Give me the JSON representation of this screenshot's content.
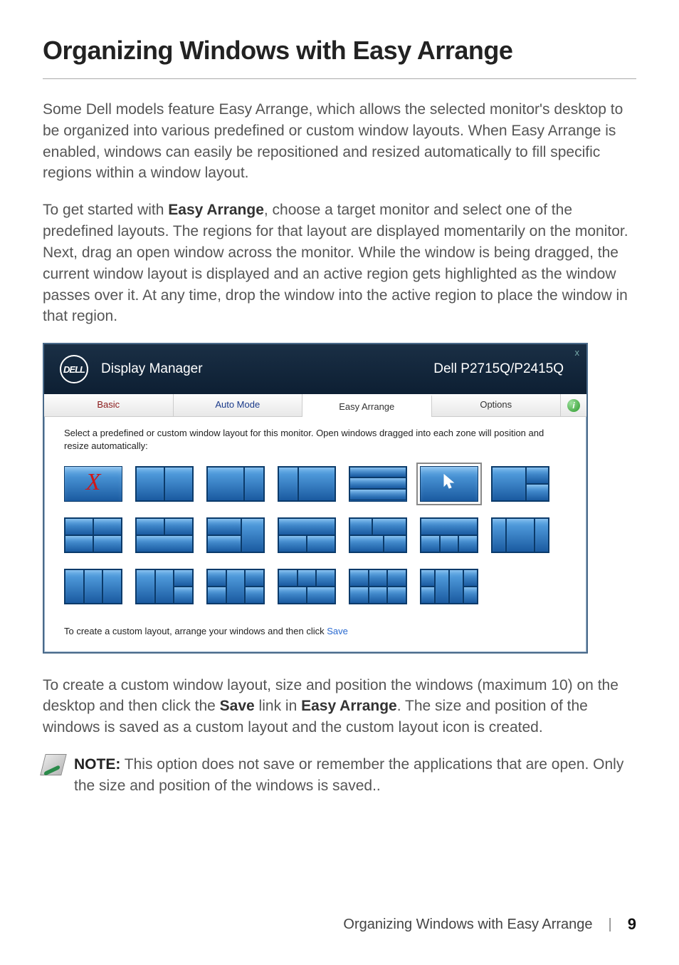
{
  "heading": "Organizing Windows with Easy Arrange",
  "para1": "Some Dell models feature Easy Arrange, which allows the selected monitor's desktop to be organized into various predefined or custom window layouts. When Easy Arrange is enabled, windows can easily be repositioned and resized automatically to fill specific regions within a window layout.",
  "para2_pre": "To get started with ",
  "para2_bold": "Easy Arrange",
  "para2_post": ", choose a target monitor and select one of the predefined layouts. The regions for that layout are displayed momentarily on the monitor. Next, drag an open window across the monitor. While the window is being dragged, the current window layout is displayed and an active region gets highlighted as the window passes over it. At any time, drop the window into the active region to place the window in that region.",
  "app": {
    "logo_text": "DELL",
    "title": "Display Manager",
    "monitor": "Dell P2715Q/P2415Q",
    "close": "x",
    "tabs": {
      "basic": "Basic",
      "auto": "Auto Mode",
      "easy": "Easy Arrange",
      "options": "Options"
    },
    "info_glyph": "i",
    "panel_desc": "Select a predefined or custom window layout for this monitor. Open windows dragged into each zone will position and resize automatically:",
    "footer_text": "To create a custom layout, arrange your windows and then click ",
    "footer_link": "Save",
    "x_glyph": "X",
    "cursor_glyph": "↖"
  },
  "para3_a": "To create a custom window layout, size and position the windows (maximum 10) on the desktop and then click the ",
  "para3_b1": "Save",
  "para3_b": " link in ",
  "para3_b2": "Easy Arrange",
  "para3_c": ". The size and position of the windows is saved as a custom layout and the custom layout icon is created.",
  "note_label": "NOTE:",
  "note_text": " This option does not save or remember the applications that are open. Only the size and position of the windows is saved..",
  "footer": {
    "title": "Organizing Windows with Easy Arrange",
    "sep": "|",
    "page": "9"
  }
}
